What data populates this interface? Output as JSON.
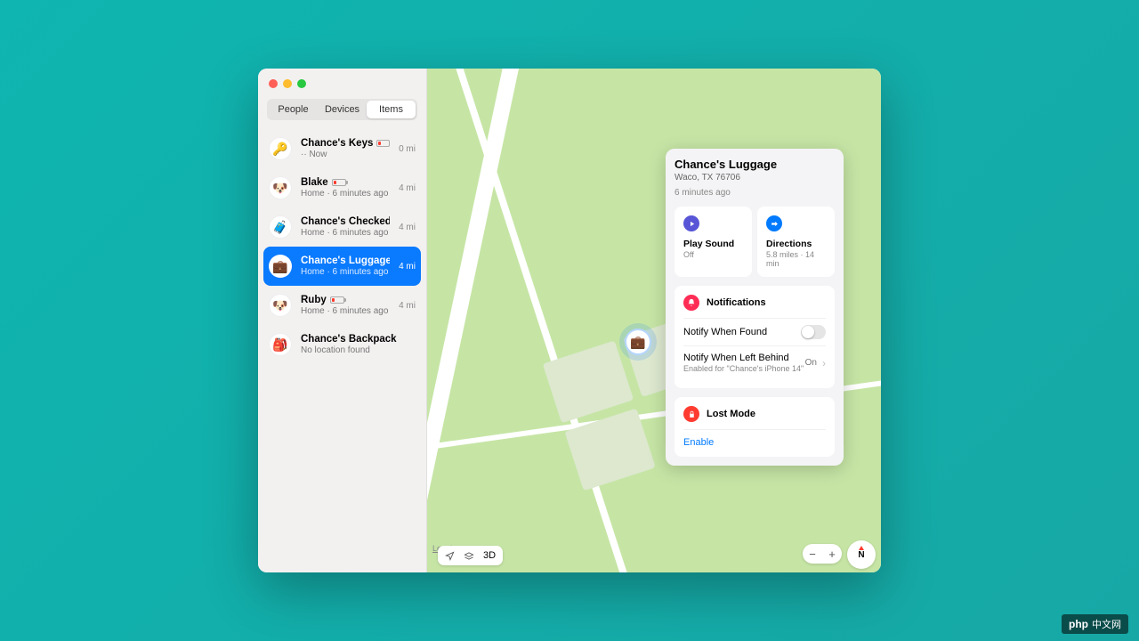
{
  "window": {
    "tabs": [
      "People",
      "Devices",
      "Items"
    ],
    "active_tab_index": 2
  },
  "items": [
    {
      "emoji": "🔑",
      "name": "Chance's Keys",
      "sub": "·· Now",
      "dist": "0 mi",
      "low_batt": true
    },
    {
      "emoji": "🐶",
      "name": "Blake",
      "sub": "Home · 6 minutes ago",
      "dist": "4 mi",
      "low_batt": true
    },
    {
      "emoji": "🧳",
      "name": "Chance's Checked L...",
      "sub": "Home · 6 minutes ago",
      "dist": "4 mi",
      "low_batt": true
    },
    {
      "emoji": "💼",
      "name": "Chance's Luggage",
      "sub": "Home · 6 minutes ago",
      "dist": "4 mi",
      "low_batt": true,
      "selected": true
    },
    {
      "emoji": "🐶",
      "name": "Ruby",
      "sub": "Home · 6 minutes ago",
      "dist": "4 mi",
      "low_batt": true
    },
    {
      "emoji": "🎒",
      "name": "Chance's Backpack",
      "sub": "No location found",
      "dist": "",
      "low_batt": false
    }
  ],
  "detail": {
    "title": "Chance's Luggage",
    "address": "Waco, TX  76706",
    "updated": "6 minutes ago",
    "play_sound": {
      "label": "Play Sound",
      "status": "Off"
    },
    "directions": {
      "label": "Directions",
      "status": "5.8 miles · 14 min"
    },
    "notifications": {
      "heading": "Notifications",
      "when_found": {
        "label": "Notify When Found",
        "on": false
      },
      "left_behind": {
        "label": "Notify When Left Behind",
        "status": "On",
        "sub": "Enabled for \"Chance's iPhone 14\""
      }
    },
    "lost_mode": {
      "heading": "Lost Mode",
      "action": "Enable"
    }
  },
  "map": {
    "legal_label": "Legal",
    "mode_3d": "3D",
    "compass": "N",
    "pin_emoji": "💼"
  },
  "footer_badge": {
    "brand": "php",
    "text": "中文网"
  }
}
